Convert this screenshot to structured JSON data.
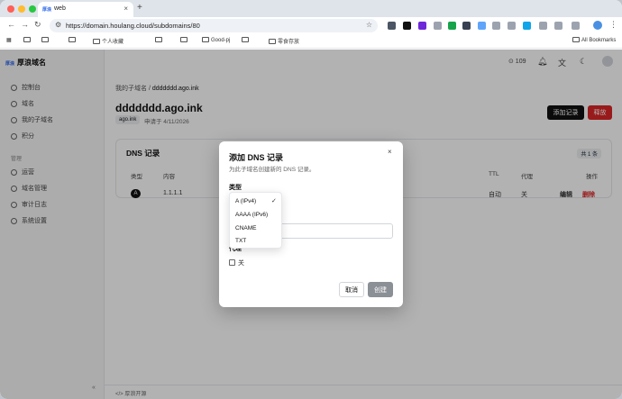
{
  "browser": {
    "tab_title": "web",
    "tab_favicon": "厚浪",
    "new_tab": "+",
    "url": "https://domain.houlang.cloud/subdomains/80",
    "bookmarks": [
      "个人收藏",
      "Good-pj",
      "零食存放"
    ],
    "all_bookmarks": "All Bookmarks"
  },
  "sidebar": {
    "brand_logo": "厚浪",
    "brand": "厚浪域名",
    "items": [
      {
        "label": "控制台",
        "icon": "home-icon"
      },
      {
        "label": "域名",
        "icon": "globe-icon"
      },
      {
        "label": "我的子域名",
        "icon": "link-icon"
      },
      {
        "label": "积分",
        "icon": "coin-icon"
      }
    ],
    "section": "管理",
    "admin_items": [
      {
        "label": "运营",
        "icon": "users-icon"
      },
      {
        "label": "域名管理",
        "icon": "globe-icon"
      },
      {
        "label": "审计日志",
        "icon": "document-icon"
      },
      {
        "label": "系统设置",
        "icon": "settings-icon"
      }
    ],
    "collapse": "«"
  },
  "topbar": {
    "points": "⊙ 109"
  },
  "page": {
    "breadcrumb_parent": "我的子域名",
    "breadcrumb_sep": "/",
    "breadcrumb_current": "ddddddd.ago.ink",
    "title": "ddddddd.ago.ink",
    "badge": "ago.ink",
    "applied": "申请于 4/11/2026",
    "add_record": "添加记录",
    "release": "释放"
  },
  "dns_card": {
    "title": "DNS 记录",
    "count": "共 1 条",
    "headers": {
      "type": "类型",
      "content": "内容",
      "ttl": "TTL",
      "proxy": "代理",
      "actions": "操作"
    },
    "row": {
      "type": "A",
      "content": "1.1.1.1",
      "ttl": "自动",
      "proxy": "关",
      "edit": "编辑",
      "delete": "删除"
    }
  },
  "footer": {
    "text": "</> 厚浪开源"
  },
  "modal": {
    "title": "添加 DNS 记录",
    "subtitle": "为此子域名创建新的 DNS 记录。",
    "type_label": "类型",
    "type_options": [
      "A (IPv4)",
      "AAAA (IPv6)",
      "CNAME",
      "TXT"
    ],
    "selected_option": "A (IPv4)",
    "proxy_label": "代理",
    "proxy_value": "关",
    "cancel": "取消",
    "create": "创建",
    "close": "×"
  }
}
